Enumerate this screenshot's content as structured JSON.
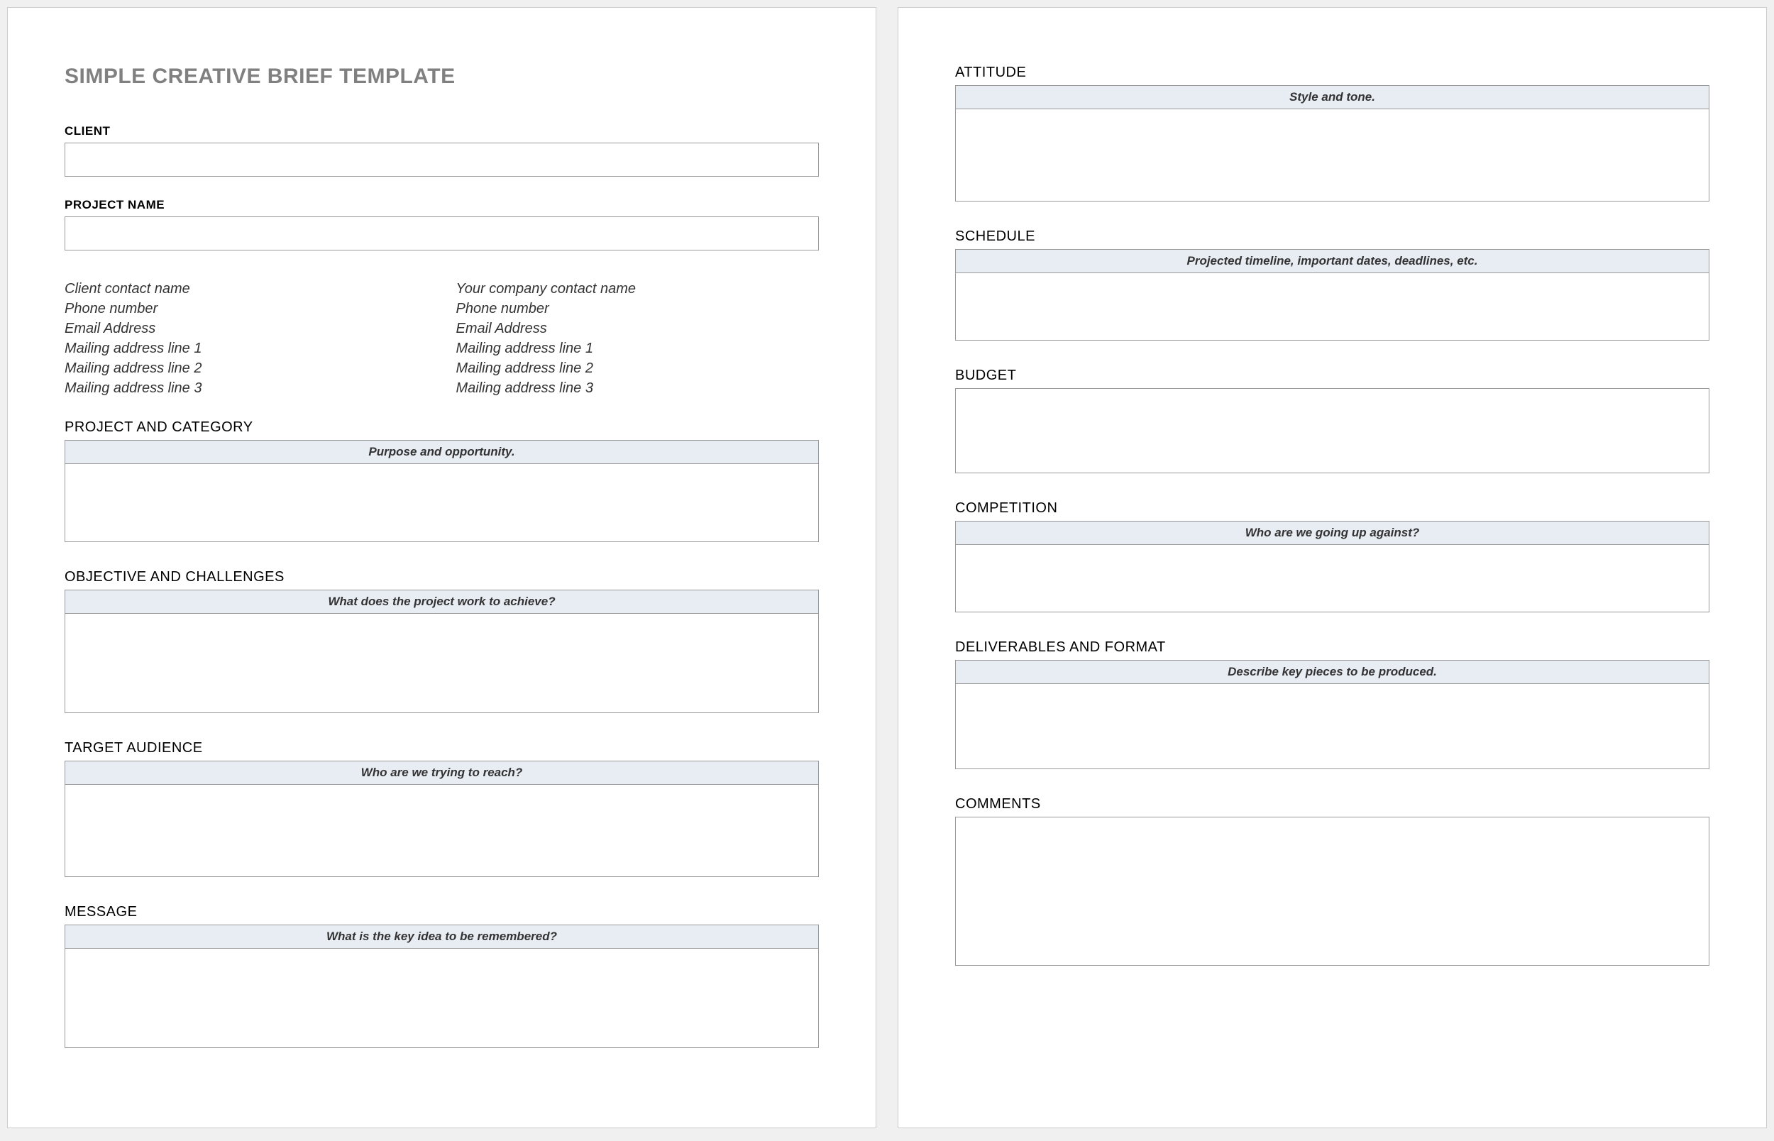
{
  "title": "SIMPLE CREATIVE BRIEF TEMPLATE",
  "fields": {
    "client_label": "CLIENT",
    "project_name_label": "PROJECT NAME"
  },
  "contacts": {
    "client": [
      "Client contact name",
      "Phone number",
      "Email Address",
      "Mailing address line 1",
      "Mailing address line 2",
      "Mailing address line 3"
    ],
    "company": [
      "Your company contact name",
      "Phone number",
      "Email Address",
      "Mailing address line 1",
      "Mailing address line 2",
      "Mailing address line 3"
    ]
  },
  "sections": {
    "project_category": {
      "label": "PROJECT AND CATEGORY",
      "hint": "Purpose and opportunity."
    },
    "objective": {
      "label": "OBJECTIVE AND CHALLENGES",
      "hint": "What does the project work to achieve?"
    },
    "target_audience": {
      "label": "TARGET AUDIENCE",
      "hint": "Who are we trying to reach?"
    },
    "message": {
      "label": "MESSAGE",
      "hint": "What is the key idea to be remembered?"
    },
    "attitude": {
      "label": "ATTITUDE",
      "hint": "Style and tone."
    },
    "schedule": {
      "label": "SCHEDULE",
      "hint": "Projected timeline, important dates, deadlines, etc."
    },
    "budget": {
      "label": "BUDGET"
    },
    "competition": {
      "label": "COMPETITION",
      "hint": "Who are we going up against?"
    },
    "deliverables": {
      "label": "DELIVERABLES AND FORMAT",
      "hint": "Describe key pieces to be produced."
    },
    "comments": {
      "label": "COMMENTS"
    }
  }
}
